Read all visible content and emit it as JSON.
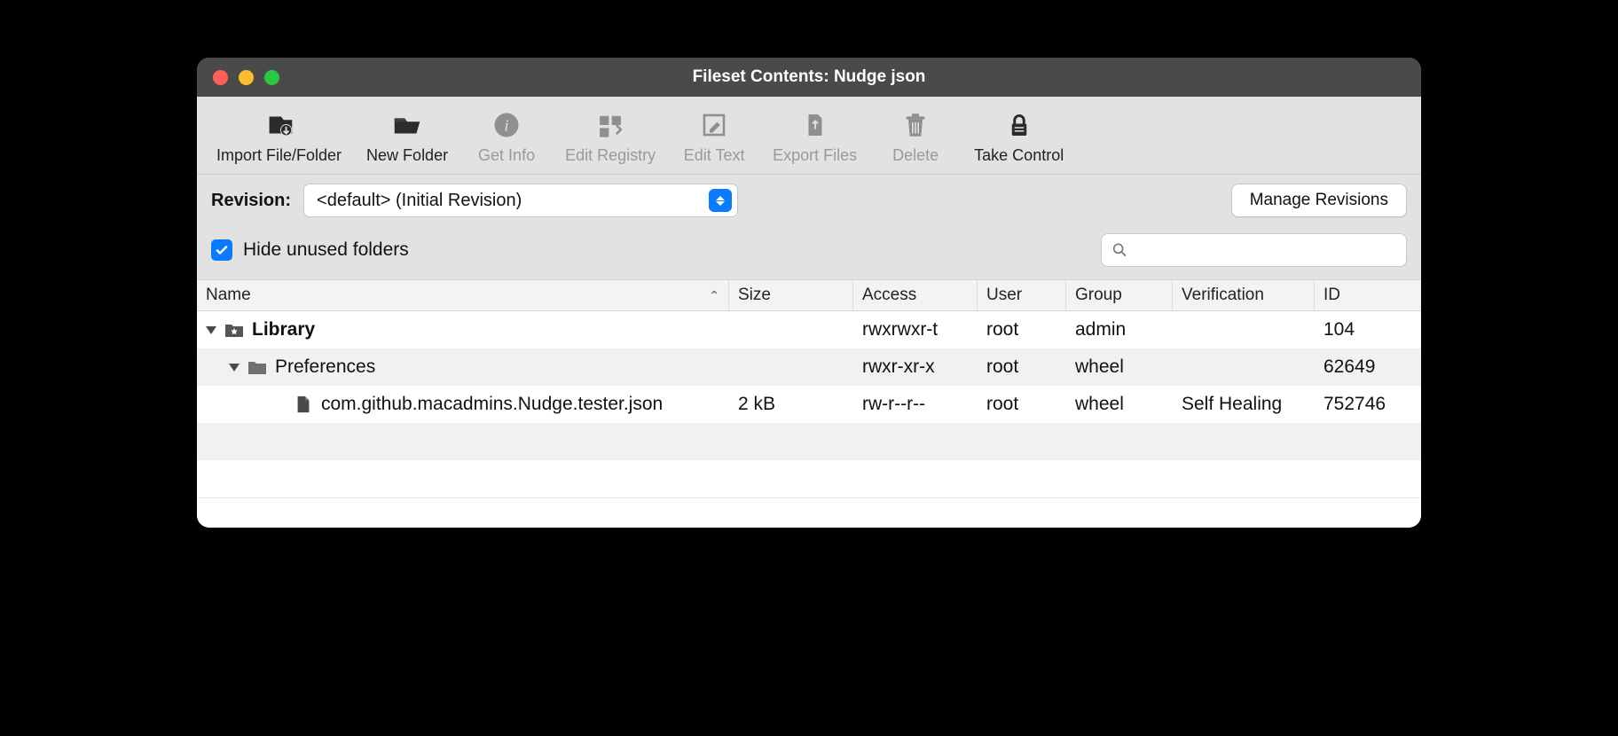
{
  "window": {
    "title": "Fileset Contents: Nudge json"
  },
  "toolbar": {
    "import": "Import File/Folder",
    "newfolder": "New Folder",
    "getinfo": "Get Info",
    "editregistry": "Edit Registry",
    "edittext": "Edit Text",
    "exportfiles": "Export Files",
    "delete": "Delete",
    "takecontrol": "Take Control"
  },
  "revision": {
    "label": "Revision:",
    "value": "<default> (Initial Revision)",
    "manage": "Manage Revisions"
  },
  "options": {
    "hide_unused": "Hide unused folders",
    "hide_unused_checked": true
  },
  "columns": {
    "name": "Name",
    "size": "Size",
    "access": "Access",
    "user": "User",
    "group": "Group",
    "verification": "Verification",
    "id": "ID"
  },
  "rows": [
    {
      "name": "Library",
      "size": "",
      "access": "rwxrwxr-t",
      "user": "root",
      "group": "admin",
      "verification": "",
      "id": "104",
      "bold": true,
      "indent": 0,
      "icon": "folder-star",
      "expanded": true
    },
    {
      "name": "Preferences",
      "size": "",
      "access": "rwxr-xr-x",
      "user": "root",
      "group": "wheel",
      "verification": "",
      "id": "62649",
      "bold": false,
      "indent": 1,
      "icon": "folder",
      "expanded": true
    },
    {
      "name": "com.github.macadmins.Nudge.tester.json",
      "size": "2 kB",
      "access": "rw-r--r--",
      "user": "root",
      "group": "wheel",
      "verification": "Self Healing",
      "id": "752746",
      "bold": false,
      "indent": 2,
      "icon": "file",
      "expanded": false
    }
  ]
}
